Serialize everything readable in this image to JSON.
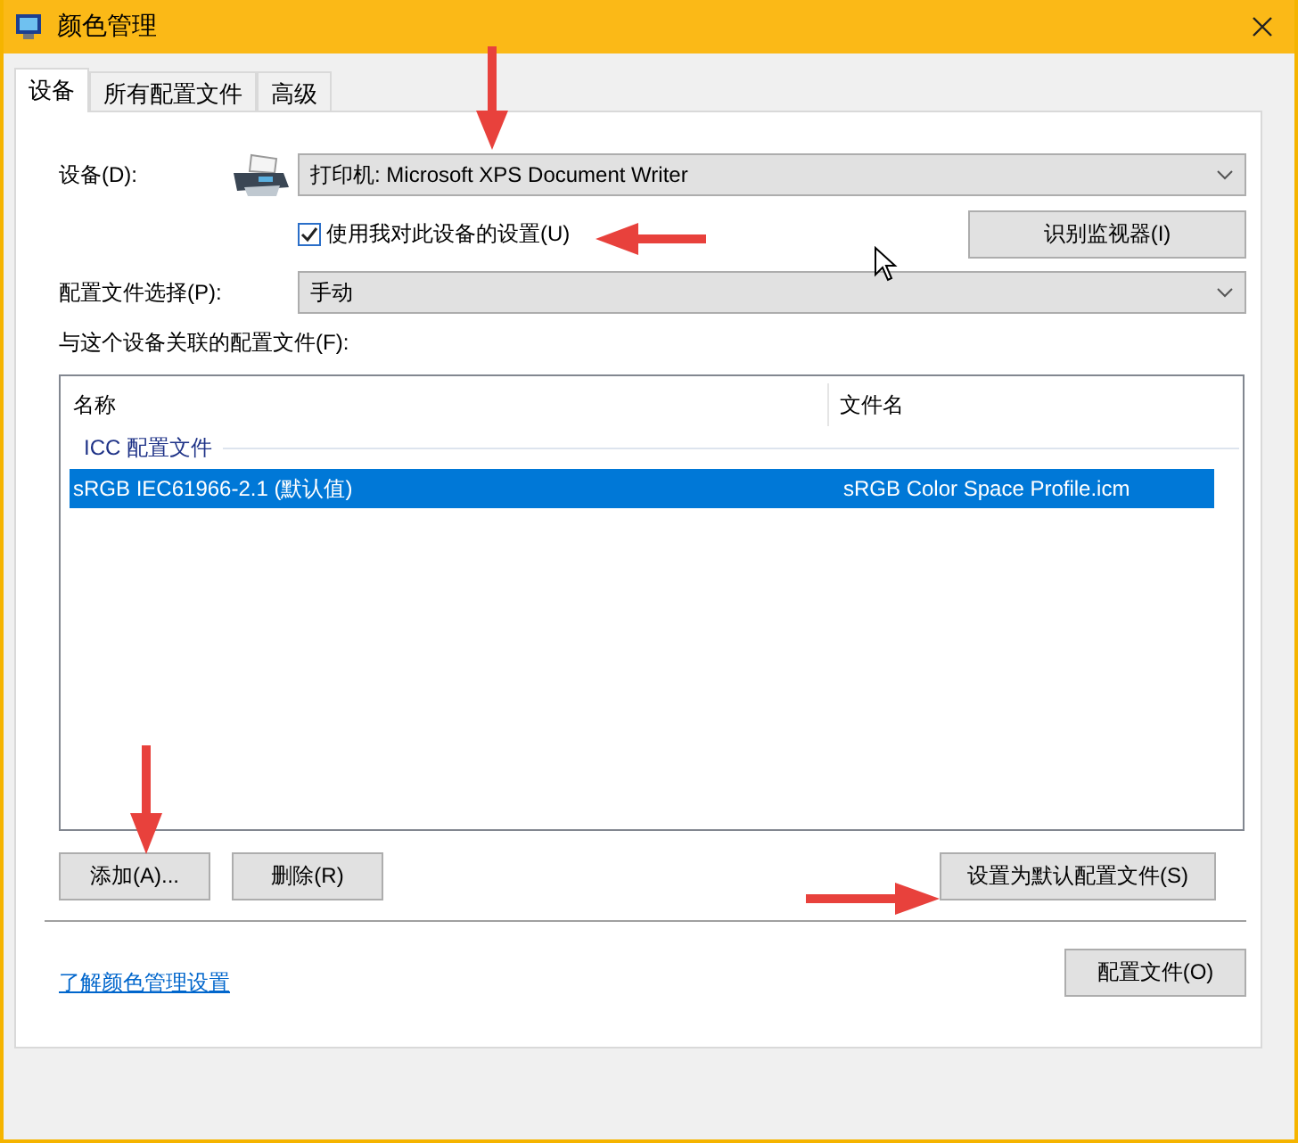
{
  "window": {
    "title": "颜色管理"
  },
  "tabs": [
    {
      "label": "设备",
      "selected": true
    },
    {
      "label": "所有配置文件",
      "selected": false
    },
    {
      "label": "高级",
      "selected": false
    }
  ],
  "device": {
    "label": "设备(D):",
    "value": "打印机: Microsoft XPS Document Writer"
  },
  "use_my_settings": {
    "label": "使用我对此设备的设置(U)",
    "checked": true
  },
  "identify_button": "识别监视器(I)",
  "profile_selection": {
    "label": "配置文件选择(P):",
    "value": "手动"
  },
  "profiles": {
    "label": "与这个设备关联的配置文件(F):",
    "columns": [
      "名称",
      "文件名"
    ],
    "groups": [
      {
        "name": "ICC 配置文件",
        "rows": [
          {
            "name": "sRGB IEC61966-2.1 (默认值)",
            "file": "sRGB Color Space Profile.icm",
            "selected": true
          }
        ]
      }
    ]
  },
  "list_buttons": [
    "添加(A)...",
    "删除(R)"
  ],
  "default_button": "设置为默认配置文件(S)",
  "link": "了解颜色管理设置",
  "profiles_button": "配置文件(O)"
}
